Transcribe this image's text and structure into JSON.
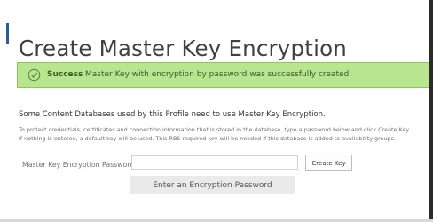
{
  "page": {
    "title": "Create Master Key Encryption"
  },
  "banner": {
    "icon": "check-circle-icon",
    "label": "Success",
    "message": "Master Key with encryption by password was successfully created.",
    "colors": {
      "background": "#b8e58f",
      "border": "#8fc45c",
      "text": "#3c5a22"
    }
  },
  "content": {
    "intro": "Some Content Databases used by this Profile need to use Master Key Encryption.",
    "help_lines": [
      "To protect credentials, certificates and connection information that is stored in the database, type a password below and click Create Key.",
      "If nothing is entered, a default key will be used. This RBS-required key will be needed if this database is added to availability groups."
    ]
  },
  "form": {
    "password_label": "Master Key Encryption Password:",
    "password_value": "",
    "create_button_label": "Create Key",
    "validation_message": "Enter an Encryption Password"
  },
  "colors": {
    "title_accent": "#2c5c99"
  }
}
